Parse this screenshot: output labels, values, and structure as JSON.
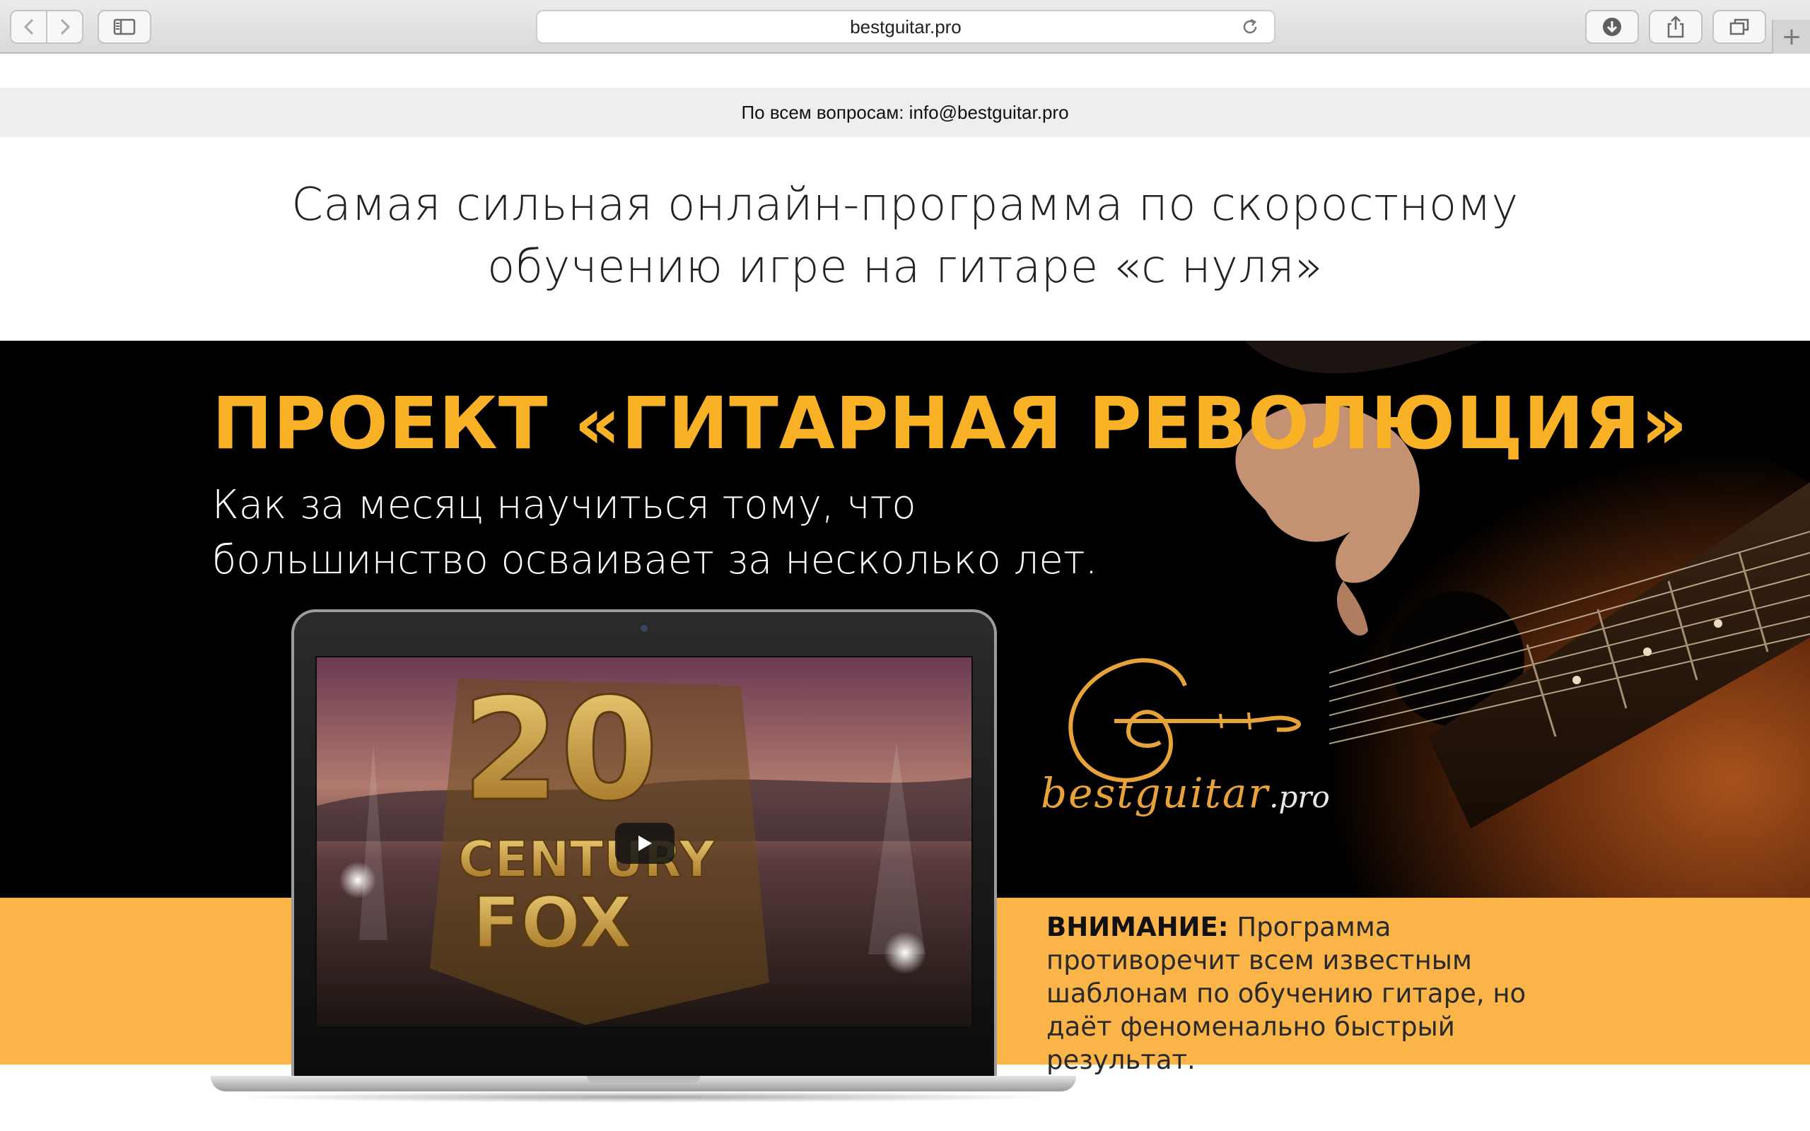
{
  "browser": {
    "url": "bestguitar.pro",
    "new_tab_glyph": "+",
    "back_icon": "chevron-left-icon",
    "forward_icon": "chevron-right-icon",
    "sidebar_icon": "sidebar-icon",
    "reload_icon": "reload-icon",
    "download_icon": "download-icon",
    "share_icon": "share-icon",
    "tabs_icon": "tabs-overview-icon"
  },
  "contact": {
    "text": "По всем вопросам: info@bestguitar.pro"
  },
  "headline": {
    "line1": "Самая сильная онлайн-программа по скоростному",
    "line2": "обучению игре на гитаре «с нуля»"
  },
  "hero": {
    "title": "ПРОЕКТ «ГИТАРНАЯ РЕВОЛЮЦИЯ»",
    "subtitle_line1": "Как за месяц научиться тому, что",
    "subtitle_line2": "большинство осваивает за несколько лет.",
    "logo_name": "bestguitar",
    "logo_tld": ".pro",
    "video_play_icon": "play-icon",
    "video_frame_text_top": "20",
    "video_frame_text_mid": "CENTURY",
    "video_frame_text_bottom": "FOX"
  },
  "notice": {
    "label": "ВНИМАНИЕ:",
    "text": " Программа противоречит всем известным шаблонам по обучению гитаре, но даёт феноменально быстрый результат."
  },
  "colors": {
    "accent_orange": "#f9b125",
    "band_orange": "#fbb447",
    "hero_bg": "#000000"
  }
}
